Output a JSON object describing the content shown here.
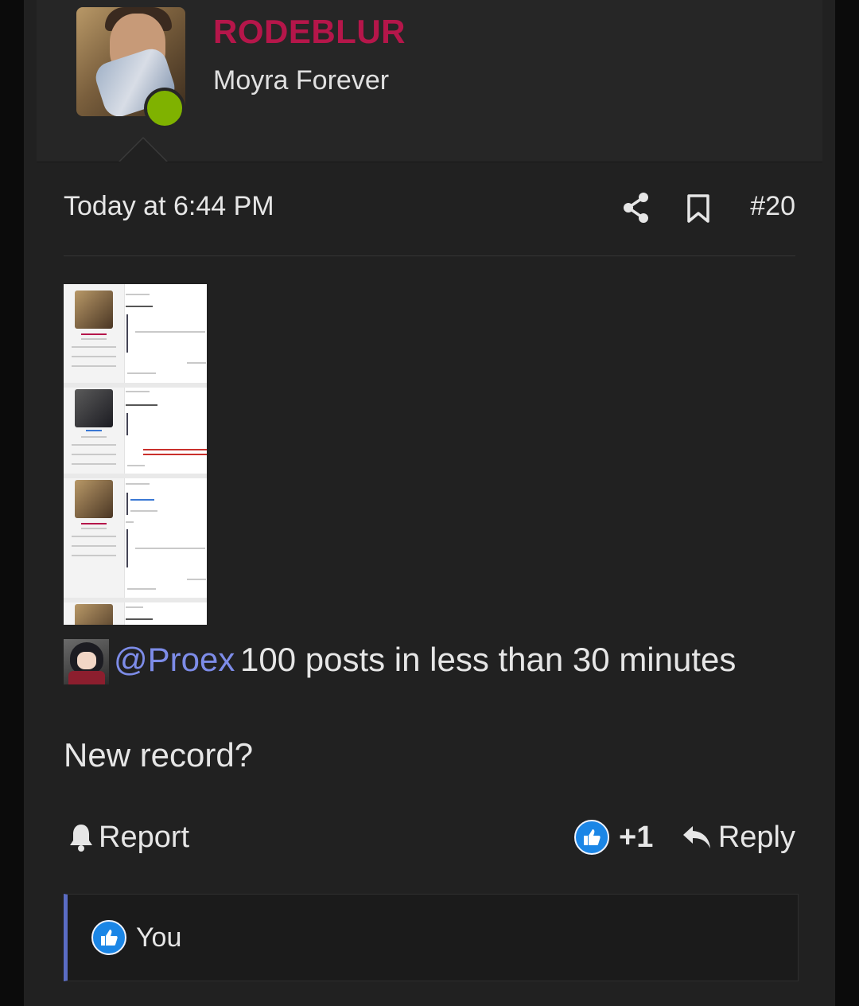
{
  "user": {
    "name": "RODEBLUR",
    "title": "Moyra Forever",
    "online": true
  },
  "post": {
    "timestamp": "Today at 6:44 PM",
    "number": "#20",
    "mention": "@Proex",
    "mention_text": "100 posts in less than 30 minutes",
    "body": "New record?"
  },
  "actions": {
    "report_label": "Report",
    "like_count": "+1",
    "reply_label": "Reply"
  },
  "reactions": {
    "label": "You"
  },
  "icons": {
    "share": "share-icon",
    "bookmark": "bookmark-icon",
    "report": "bell-icon",
    "like": "thumbs-up-icon",
    "reply": "reply-arrow-icon"
  },
  "colors": {
    "username": "#b5164a",
    "mention": "#7d8ce8",
    "online": "#7fb200",
    "like": "#1b86e6",
    "reaction_border": "#5a6cc4"
  }
}
